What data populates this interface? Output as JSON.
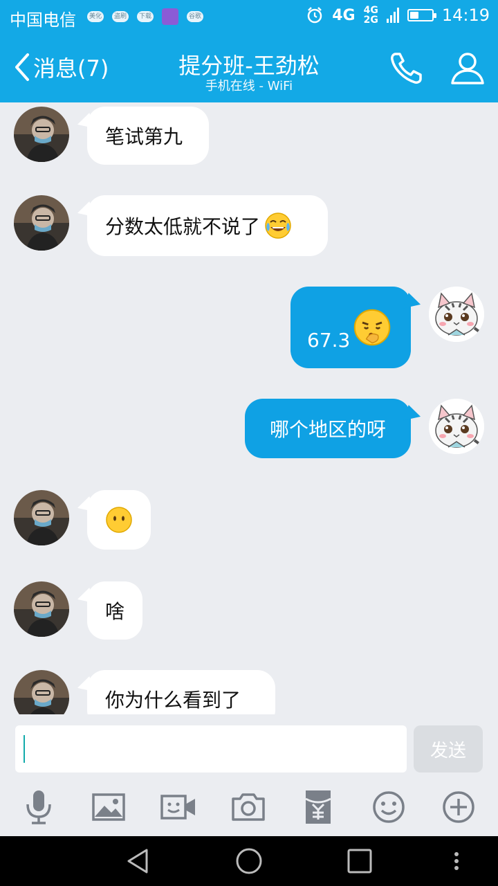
{
  "status_bar": {
    "carrier": "中国电信",
    "notifications": [
      "美化",
      "盗刷",
      "下载",
      "",
      "谷歌"
    ],
    "network_main": "4G",
    "network_small_1": "4G",
    "network_small_2": "2G",
    "battery_level": 0.4,
    "time": "14:19"
  },
  "header": {
    "back_label": "消息(7)",
    "title": "提分班-王劲松",
    "subtitle": "手机在线 - WiFi",
    "call_icon": "phone-icon",
    "profile_icon": "person-icon"
  },
  "messages": [
    {
      "side": "left",
      "text": "笔试第九"
    },
    {
      "side": "left",
      "text": "分数太低就不说了",
      "emoji": "tears-of-joy"
    },
    {
      "side": "right",
      "text": "67.3",
      "emoji": "thinking-face"
    },
    {
      "side": "right",
      "text": "哪个地区的呀"
    },
    {
      "side": "left",
      "text": "",
      "emoji": "face-without-mouth"
    },
    {
      "side": "left",
      "text": "啥"
    },
    {
      "side": "left",
      "text": "你为什么看到了"
    }
  ],
  "composer": {
    "input_value": "",
    "send_label": "发送"
  },
  "toolbar": [
    "microphone-icon",
    "image-icon",
    "video-call-icon",
    "camera-icon",
    "red-packet-icon",
    "smiley-icon",
    "plus-icon"
  ],
  "colors": {
    "brand_blue": "#13A9E6",
    "bubble_blue": "#0FA1E4",
    "background": "#EBEDF1"
  }
}
